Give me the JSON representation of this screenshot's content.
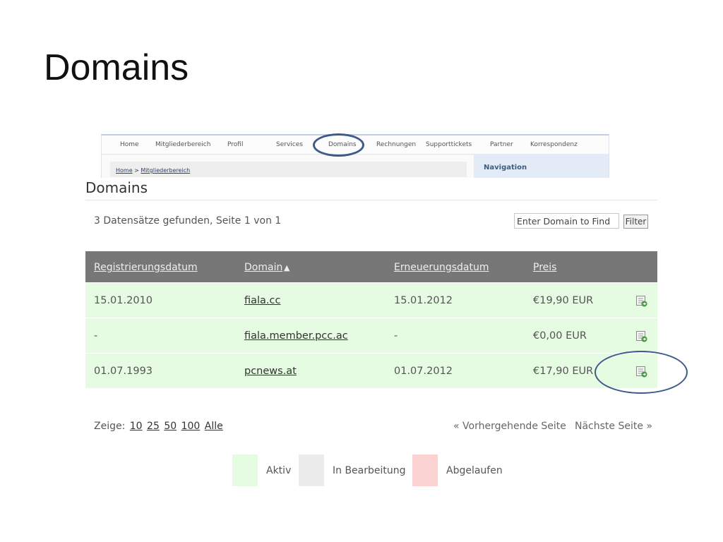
{
  "slide": {
    "title": "Domains"
  },
  "topnav": {
    "items": [
      "Home",
      "Mitgliederbereich",
      "Profil",
      "Services",
      "Domains",
      "Rechnungen",
      "Supporttickets",
      "Partner",
      "Korrespondenz"
    ],
    "breadcrumb": {
      "home": "Home",
      "separator": ">",
      "current": "Mitgliederbereich"
    },
    "panel_title": "Navigation"
  },
  "section": {
    "title": "Domains",
    "records_text": "3 Datensätze gefunden, Seite 1 von 1",
    "search": {
      "placeholder": "Enter Domain to Find",
      "value": ""
    },
    "filter_label": "Filter"
  },
  "table": {
    "headers": [
      "Registrierungsdatum",
      "Domain",
      "Erneuerungsdatum",
      "Preis"
    ],
    "sort_indicator": "▲",
    "rows": [
      {
        "registered": "15.01.2010",
        "domain": "fiala.cc",
        "renewal": "15.01.2012",
        "price": "€19,90 EUR"
      },
      {
        "registered": "-",
        "domain": "fiala.member.pcc.ac",
        "renewal": "-",
        "price": "€0,00 EUR"
      },
      {
        "registered": "01.07.1993",
        "domain": "pcnews.at",
        "renewal": "01.07.2012",
        "price": "€17,90 EUR"
      }
    ],
    "row_color": "#e5fbe2",
    "header_color": "#777777"
  },
  "pagination": {
    "show_label": "Zeige:",
    "sizes": [
      "10",
      "25",
      "50",
      "100",
      "Alle"
    ],
    "prev": "« Vorhergehende Seite",
    "next": "Nächste Seite »"
  },
  "legend": [
    {
      "label": "Aktiv",
      "color": "#e5fbe2"
    },
    {
      "label": "In Bearbeitung",
      "color": "#ececec"
    },
    {
      "label": "Abgelaufen",
      "color": "#fbd3d3"
    }
  ],
  "icons": {
    "row_action": "edit-domain-icon"
  },
  "annotation_color": "#3d5a88"
}
